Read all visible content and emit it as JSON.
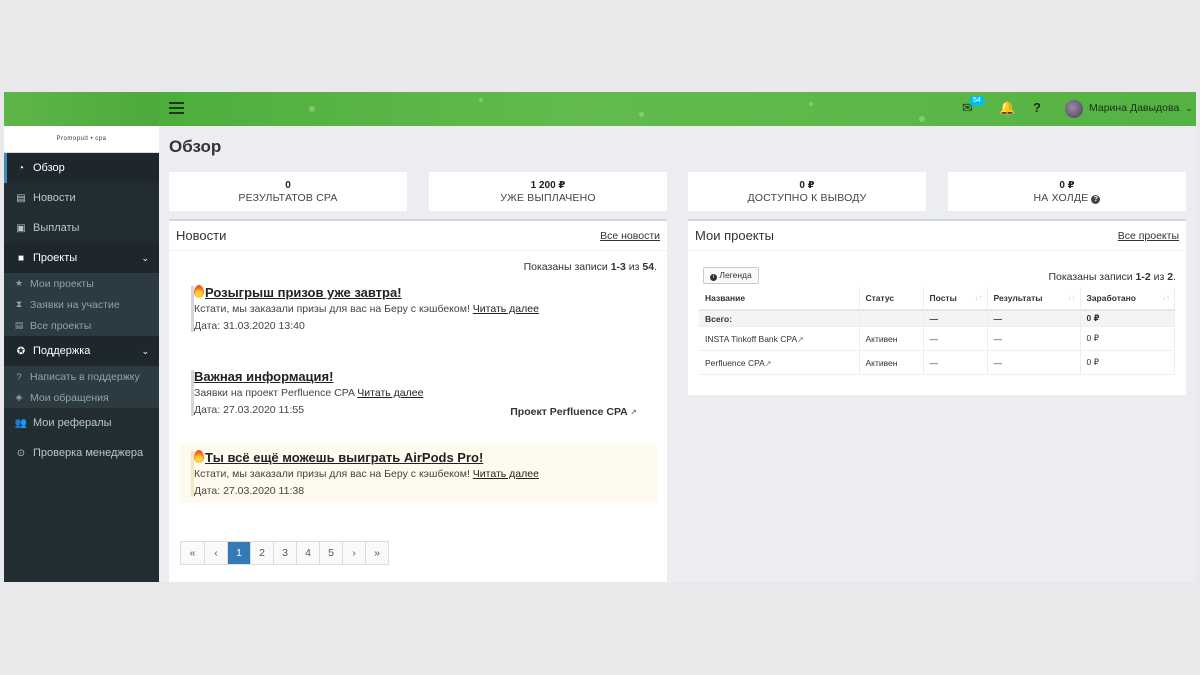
{
  "sidebar": {
    "brand": "Promopult • cpa",
    "items": [
      {
        "label": "Обзор",
        "icon": "dashboard-icon"
      },
      {
        "label": "Новости",
        "icon": "newspaper-icon"
      },
      {
        "label": "Выплаты",
        "icon": "money-icon"
      },
      {
        "label": "Проекты",
        "icon": "briefcase-icon"
      },
      {
        "label": "Поддержка",
        "icon": "lifebuoy-icon"
      },
      {
        "label": "Мои рефералы",
        "icon": "users-icon"
      },
      {
        "label": "Проверка менеджера",
        "icon": "check-circle-icon"
      }
    ],
    "projects_sub": [
      {
        "label": "Мои проекты",
        "icon": "star-icon"
      },
      {
        "label": "Заявки на участие",
        "icon": "hourglass-icon"
      },
      {
        "label": "Все проекты",
        "icon": "list-icon"
      }
    ],
    "support_sub": [
      {
        "label": "Написать в поддержку",
        "icon": "question-icon"
      },
      {
        "label": "Мои обращения",
        "icon": "tag-icon"
      }
    ]
  },
  "topbar": {
    "notifications_badge": "54",
    "help": "?",
    "user_name": "Марина Давыдова",
    "caret": "⌄"
  },
  "page": {
    "title": "Обзор"
  },
  "stats": [
    {
      "value": "0",
      "label": "РЕЗУЛЬТАТОВ CPA"
    },
    {
      "value": "1 200 ₽",
      "label": "УЖЕ ВЫПЛАЧЕНО"
    },
    {
      "value": "0 ₽",
      "label": "ДОСТУПНО К ВЫВОДУ"
    },
    {
      "value": "0 ₽",
      "label": "НА ХОЛДЕ"
    }
  ],
  "news": {
    "title": "Новости",
    "all_link": "Все новости",
    "shown_prefix": "Показаны записи ",
    "shown_range": "1-3",
    "shown_of": " из ",
    "shown_total": "54",
    "shown_suffix": ".",
    "items": [
      {
        "title": "Розыгрыш призов уже завтра!",
        "text": "Кстати, мы заказали призы для вас на Беру с кэшбеком! ",
        "more": "Читать далее",
        "date": "Дата: 31.03.2020 13:40"
      },
      {
        "title": "Важная информация!",
        "text": "Заявки на проект Perfluence CPA ",
        "more": "Читать далее",
        "date": "Дата: 27.03.2020 11:55",
        "project": "Проект Perfluence CPA"
      },
      {
        "title": "Ты всё ещё можешь выиграть AirPods Pro!",
        "text": "Кстати, мы заказали призы для вас на Беру с кэшбеком! ",
        "more": "Читать далее",
        "date": "Дата: 27.03.2020 11:38"
      }
    ],
    "pagination": [
      "«",
      "‹",
      "1",
      "2",
      "3",
      "4",
      "5",
      "›",
      "»"
    ],
    "active_page": "1"
  },
  "projects": {
    "title": "Мои проекты",
    "all_link": "Все проекты",
    "legend_btn": "Легенда",
    "shown_prefix": "Показаны записи ",
    "shown_range": "1-2",
    "shown_of": " из ",
    "shown_total": "2",
    "shown_suffix": ".",
    "columns": [
      "Название",
      "Статус",
      "Посты",
      "Результаты",
      "Заработано"
    ],
    "total": {
      "label": "Всего:",
      "status": "",
      "posts": "—",
      "results": "—",
      "earned": "0 ₽"
    },
    "rows": [
      {
        "name": "INSTA Tinkoff Bank CPA",
        "status": "Активен",
        "posts": "—",
        "results": "—",
        "earned": "0 ₽"
      },
      {
        "name": "Perfluence CPA",
        "status": "Активен",
        "posts": "—",
        "results": "—",
        "earned": "0 ₽"
      }
    ]
  }
}
